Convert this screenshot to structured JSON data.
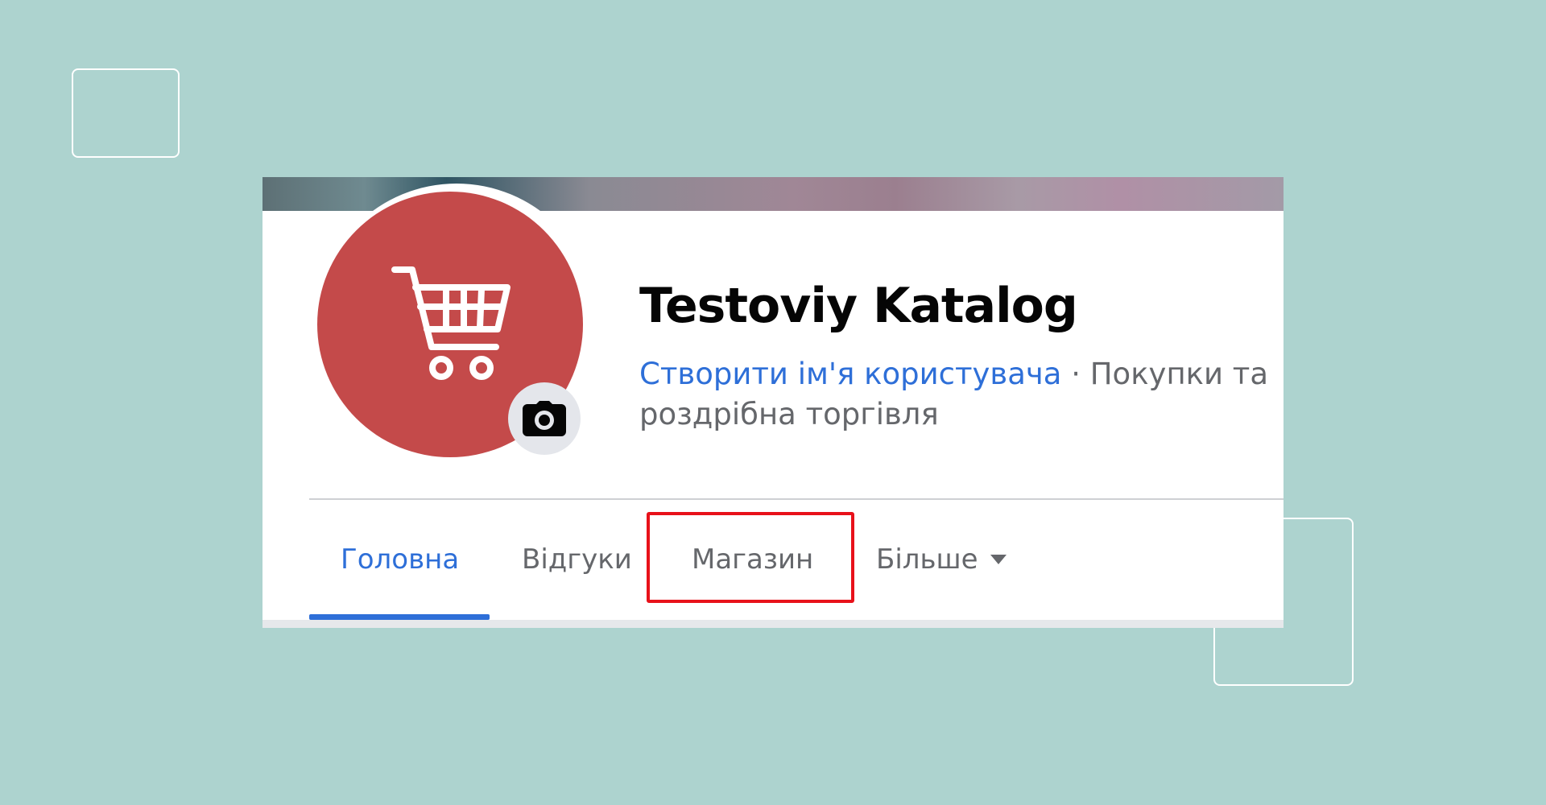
{
  "page": {
    "title": "Testoviy Katalog",
    "username_link": "Створити ім'я користувача",
    "separator": " · ",
    "category": "Покупки та роздрібна торгівля"
  },
  "tabs": [
    {
      "label": "Головна",
      "active": true
    },
    {
      "label": "Відгуки",
      "active": false
    },
    {
      "label": "Магазин",
      "active": false,
      "highlighted": true
    },
    {
      "label": "Більше",
      "active": false,
      "has_dropdown": true
    }
  ],
  "avatar": {
    "icon": "shopping-cart-icon",
    "color": "#c44a4a"
  },
  "colors": {
    "background": "#add3cf",
    "accent": "#2e6fd8",
    "highlight": "#e8111a",
    "muted_text": "#65676b"
  }
}
